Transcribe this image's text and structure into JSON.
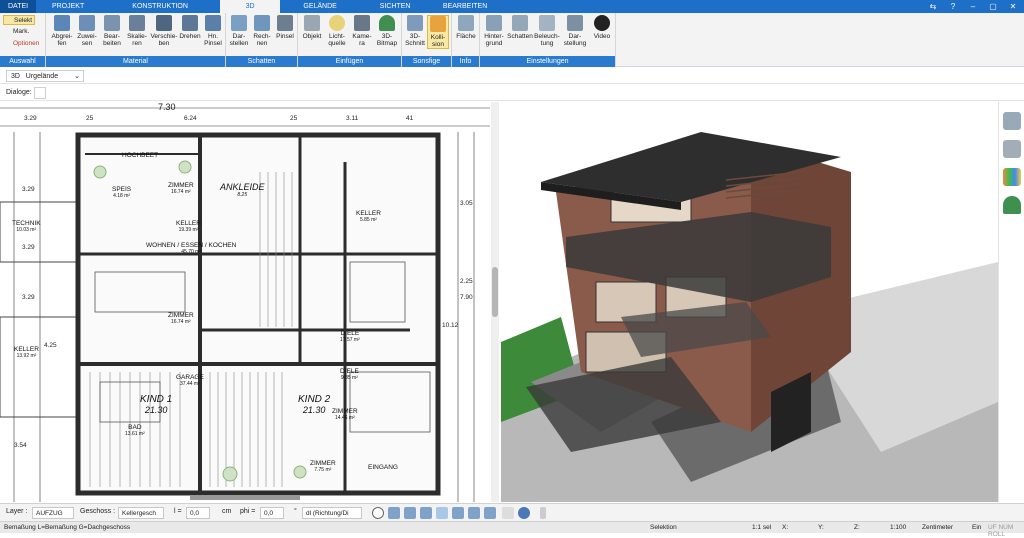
{
  "menu": {
    "items": [
      "DATEI",
      "PROJEKT",
      "KONSTRUKTION",
      "3D",
      "GELÄNDE",
      "SICHTEN",
      "BEARBEITEN"
    ],
    "active": "3D"
  },
  "ribbon": {
    "auswahl": {
      "label": "Auswahl",
      "selekt": "Selekt",
      "mark": "Mark.",
      "optionen": "Optionen"
    },
    "material": {
      "label": "Material",
      "tools": [
        "Abgrei-\nfen",
        "Zuwei-\nsen",
        "Bear-\nbeiten",
        "Skalie-\nren",
        "Verschie-\nben",
        "Drehen",
        "Hn.\nPinsel"
      ]
    },
    "schatten": {
      "label": "Schatten",
      "tools": [
        "Dar-\nstellen",
        "Rech-\nnen",
        "Pinsel"
      ]
    },
    "einfuegen": {
      "label": "Einfügen",
      "tools": [
        "Objekt",
        "Licht-\nquelle",
        "Kame-\nra",
        "3D-\nBitmap"
      ]
    },
    "sonsfige": {
      "label": "Sonsfige",
      "tools": [
        "3D-\nSchnitt",
        "Kolli-\nsion"
      ]
    },
    "info": {
      "label": "Info",
      "tools": [
        "Fläche"
      ]
    },
    "einstellungen": {
      "label": "Einstellungen",
      "tools": [
        "Hinter-\ngrund",
        "Schatten",
        "Beleuch-\ntung",
        "Dar-\nstellung",
        "Video"
      ]
    }
  },
  "view_selector": {
    "mode": "3D",
    "value": "Urgelände"
  },
  "dialoge_label": "Dialoge:",
  "plan": {
    "dims_top": [
      "3.29",
      "25",
      "6.24",
      "25",
      "3.11",
      "41"
    ],
    "dim_title": "7.30",
    "dims_left": [
      "3.29",
      "3.29",
      "3.29",
      "4.25",
      "3.54"
    ],
    "dims_right": [
      "10.12",
      "7.90",
      "2.25",
      "3.05"
    ],
    "rooms": [
      {
        "name": "HOCHBEET",
        "area": ""
      },
      {
        "name": "SPEIS",
        "area": "4.18 m²"
      },
      {
        "name": "ZIMMER",
        "area": "16.74 m²"
      },
      {
        "name": "ANKLEIDE",
        "area": "8.25"
      },
      {
        "name": "KELLER",
        "area": "5.85 m²"
      },
      {
        "name": "TECHNIK",
        "area": "10.03 m²"
      },
      {
        "name": "KELLER",
        "area": "19.39 m²"
      },
      {
        "name": "WOHNEN / ESSEN / KOCHEN",
        "area": "45.70 m²"
      },
      {
        "name": "ZIMMER",
        "area": "16.74 m²"
      },
      {
        "name": "DIELE",
        "area": "17.57 m²"
      },
      {
        "name": "KELLER",
        "area": "13.92 m²"
      },
      {
        "name": "GARAGE",
        "area": "37.44 m²"
      },
      {
        "name": "DIELE",
        "area": "9.85 m²"
      },
      {
        "name": "BAD",
        "area": "13.61 m²"
      },
      {
        "name": "ZIMMER",
        "area": "14.46 m²"
      },
      {
        "name": "ZIMMER",
        "area": "7.75 m²"
      },
      {
        "name": "EINGANG",
        "area": ""
      },
      {
        "name": "KIND 1",
        "area": "21.30"
      },
      {
        "name": "KIND 2",
        "area": "21.30"
      }
    ]
  },
  "bottom": {
    "layer_label": "Layer :",
    "layer_value": "AUFZUG",
    "geschoss_label": "Geschoss :",
    "geschoss_value": "Kellergesch",
    "l_label": "l =",
    "l_value": "0,0",
    "l_unit": "cm",
    "phi_label": "phi =",
    "phi_value": "0,0",
    "phi_unit": "°",
    "dl_value": "dl (Richtung/Di"
  },
  "status": {
    "hint": "Bemaßung L=Bemaßung G=Dachgeschoss",
    "mode": "Selektion",
    "sel": "1:1 sel",
    "x": "X:",
    "y": "Y:",
    "z": "Z:",
    "scale": "1:100",
    "unit": "Zentimeter",
    "ein": "Ein",
    "flags": "UF NUM ROLL"
  },
  "colors": {
    "accent": "#1d6fc7",
    "ribbon_group": "#2a7bd0",
    "selected": "#f9e7a4"
  }
}
